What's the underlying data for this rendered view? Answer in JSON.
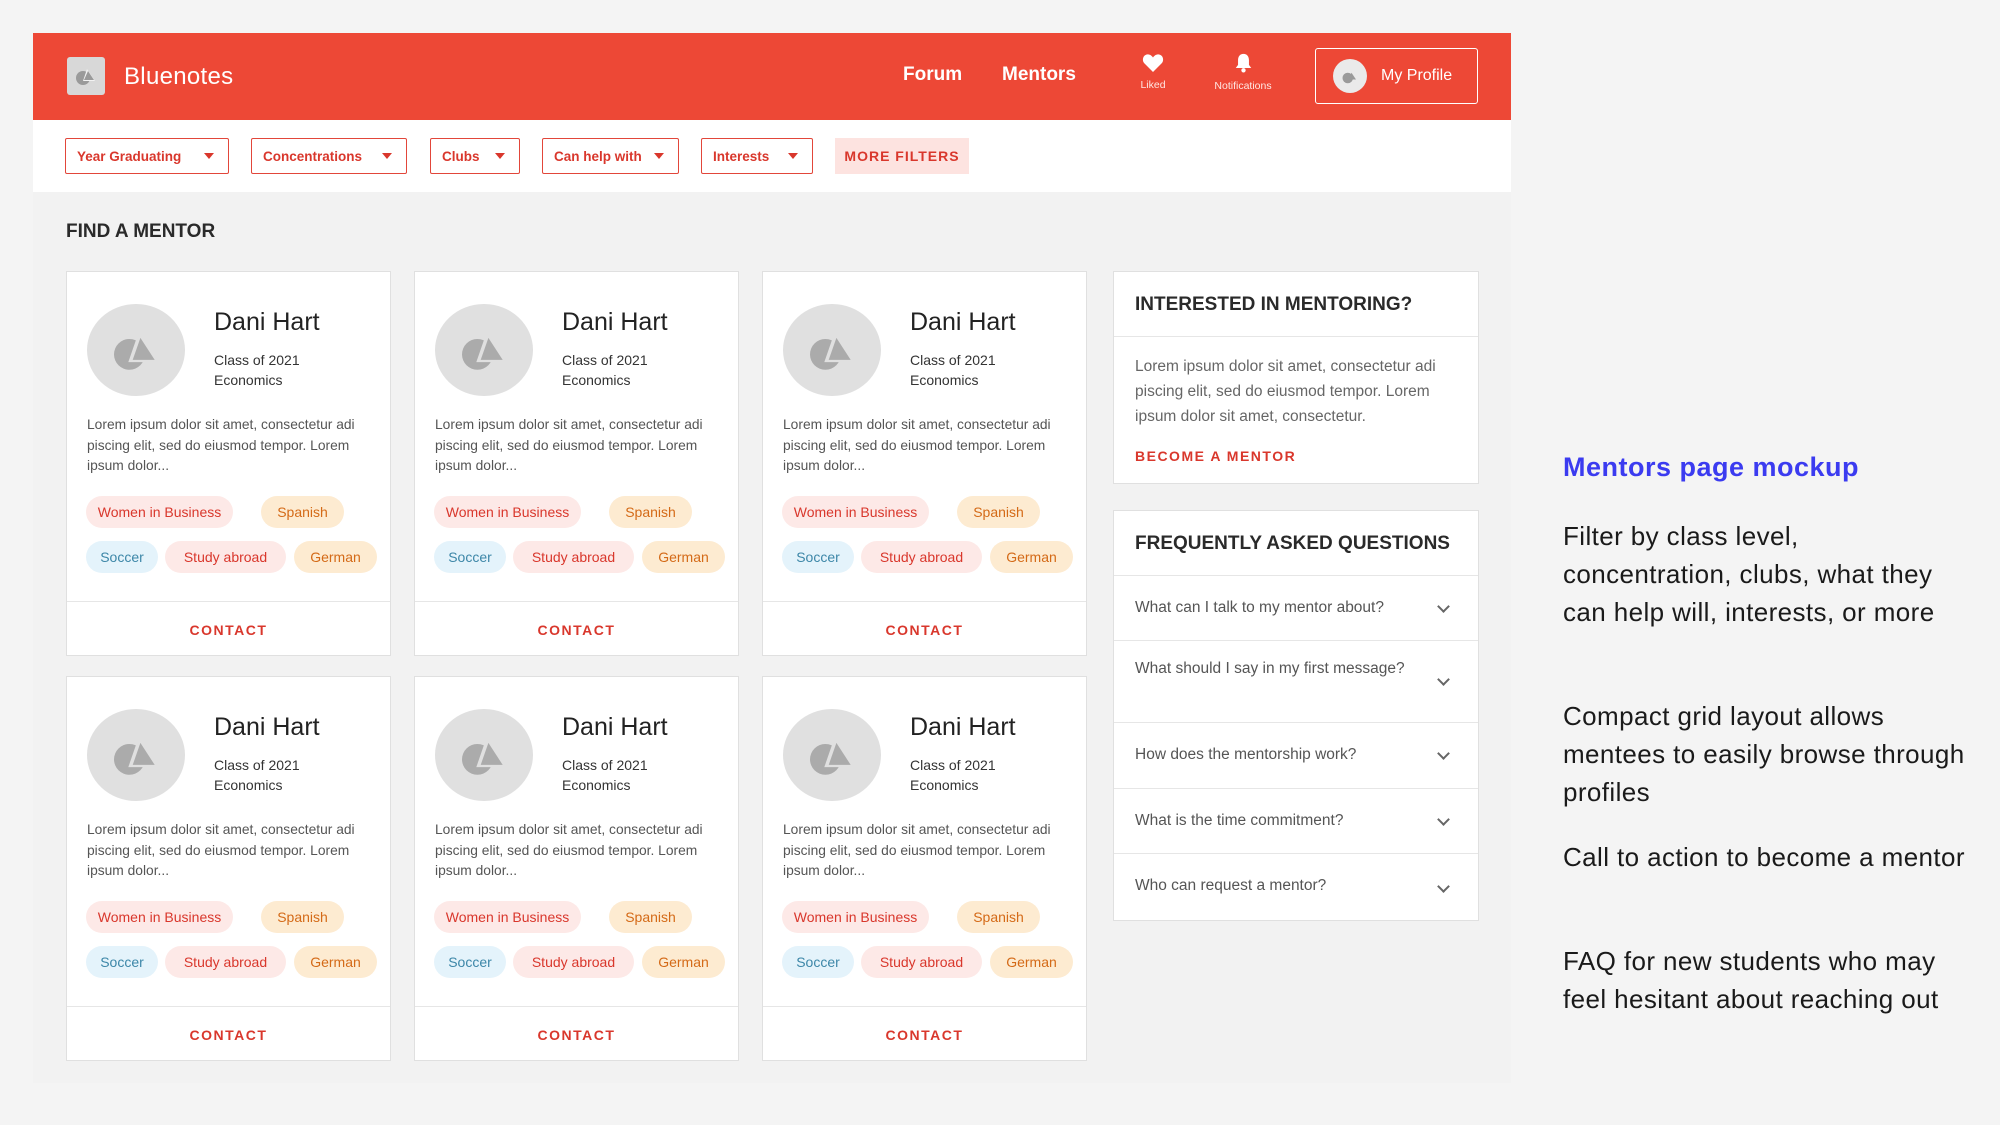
{
  "app": {
    "brand": "Bluenotes"
  },
  "nav": {
    "forum": "Forum",
    "mentors": "Mentors",
    "liked": "Liked",
    "notifications": "Notifications",
    "profile": "My Profile"
  },
  "filters": {
    "year": "Year Graduating",
    "concentrations": "Concentrations",
    "clubs": "Clubs",
    "help": "Can help with",
    "interests": "Interests",
    "more": "MORE FILTERS"
  },
  "section_title": "FIND A MENTOR",
  "mentors": [
    {
      "name": "Dani Hart",
      "class": "Class of 2021",
      "concentration": "Economics",
      "bio": "Lorem ipsum dolor sit amet, consectetur adi piscing elit, sed do eiusmod tempor. Lorem ipsum dolor...",
      "tags": [
        "Women in Business",
        "Spanish",
        "Soccer",
        "Study abroad",
        "German"
      ],
      "contact": "CONTACT"
    },
    {
      "name": "Dani Hart",
      "class": "Class of 2021",
      "concentration": "Economics",
      "bio": "Lorem ipsum dolor sit amet, consectetur adi piscing elit, sed do eiusmod tempor. Lorem ipsum dolor...",
      "tags": [
        "Women in Business",
        "Spanish",
        "Soccer",
        "Study abroad",
        "German"
      ],
      "contact": "CONTACT"
    },
    {
      "name": "Dani Hart",
      "class": "Class of 2021",
      "concentration": "Economics",
      "bio": "Lorem ipsum dolor sit amet, consectetur adi piscing elit, sed do eiusmod tempor. Lorem ipsum dolor...",
      "tags": [
        "Women in Business",
        "Spanish",
        "Soccer",
        "Study abroad",
        "German"
      ],
      "contact": "CONTACT"
    },
    {
      "name": "Dani Hart",
      "class": "Class of 2021",
      "concentration": "Economics",
      "bio": "Lorem ipsum dolor sit amet, consectetur adi piscing elit, sed do eiusmod tempor. Lorem ipsum dolor...",
      "tags": [
        "Women in Business",
        "Spanish",
        "Soccer",
        "Study abroad",
        "German"
      ],
      "contact": "CONTACT"
    },
    {
      "name": "Dani Hart",
      "class": "Class of 2021",
      "concentration": "Economics",
      "bio": "Lorem ipsum dolor sit amet, consectetur adi piscing elit, sed do eiusmod tempor. Lorem ipsum dolor...",
      "tags": [
        "Women in Business",
        "Spanish",
        "Soccer",
        "Study abroad",
        "German"
      ],
      "contact": "CONTACT"
    },
    {
      "name": "Dani Hart",
      "class": "Class of 2021",
      "concentration": "Economics",
      "bio": "Lorem ipsum dolor sit amet, consectetur adi piscing elit, sed do eiusmod tempor. Lorem ipsum dolor...",
      "tags": [
        "Women in Business",
        "Spanish",
        "Soccer",
        "Study abroad",
        "German"
      ],
      "contact": "CONTACT"
    }
  ],
  "mentoring_panel": {
    "title": "INTERESTED IN MENTORING?",
    "body": "Lorem ipsum dolor sit amet, consectetur adi piscing elit, sed do eiusmod tempor. Lorem ipsum dolor sit amet, consectetur.",
    "cta": "BECOME A MENTOR"
  },
  "faq": {
    "title": "FREQUENTLY ASKED QUESTIONS",
    "items": [
      "What can I talk to my mentor about?",
      "What should I say in my first message?",
      "How does the mentorship work?",
      "What is the time commitment?",
      "Who can request a mentor?"
    ]
  },
  "annotation": {
    "title": "Mentors page mockup",
    "notes": [
      "Filter by class level, concentration, clubs, what they can help will, interests, or more",
      "Compact grid layout allows mentees to easily browse through profiles",
      "Call to action to become a mentor",
      "FAQ for new students who may feel hesitant about reaching out"
    ]
  },
  "colors": {
    "brand": "#ed4836",
    "accent_text": "#d9372c",
    "annotation_title": "#3b3bf0"
  }
}
